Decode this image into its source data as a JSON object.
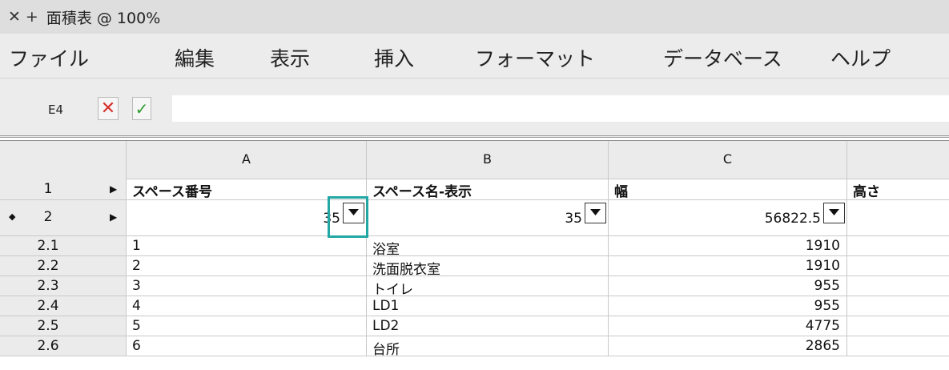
{
  "window": {
    "close_glyph": "✕",
    "add_glyph": "+",
    "title": "面積表 @ 100%"
  },
  "menu": [
    {
      "label": "ファイル"
    },
    {
      "label": "編集"
    },
    {
      "label": "表示"
    },
    {
      "label": "挿入"
    },
    {
      "label": "フォーマット"
    },
    {
      "label": "データベース"
    },
    {
      "label": "ヘルプ"
    }
  ],
  "formula_bar": {
    "cell_ref": "E4",
    "cancel_glyph": "✕",
    "accept_glyph": "✓",
    "value": ""
  },
  "grid": {
    "columns": [
      "A",
      "B",
      "C",
      ""
    ],
    "rows": [
      {
        "num": "1",
        "arrow": "▶",
        "cells": [
          "スペース番号",
          "スペース名-表示",
          "幅",
          "高さ"
        ]
      },
      {
        "num": "2",
        "marker": "◆",
        "arrow": "▶",
        "cells": [
          "35",
          "35",
          "56822.5",
          ""
        ]
      },
      {
        "num": "2.1",
        "cells": [
          "1",
          "浴室",
          "1910",
          ""
        ]
      },
      {
        "num": "2.2",
        "cells": [
          "2",
          "洗面脱衣室",
          "1910",
          ""
        ]
      },
      {
        "num": "2.3",
        "cells": [
          "3",
          "トイレ",
          "955",
          ""
        ]
      },
      {
        "num": "2.4",
        "cells": [
          "4",
          "LD1",
          "955",
          ""
        ]
      },
      {
        "num": "2.5",
        "cells": [
          "5",
          "LD2",
          "4775",
          ""
        ]
      },
      {
        "num": "2.6",
        "cells": [
          "6",
          "台所",
          "2865",
          ""
        ]
      }
    ]
  },
  "colors": {
    "focus": "#22a6a6",
    "cancel": "#d6322c",
    "accept": "#2e9a2e"
  }
}
